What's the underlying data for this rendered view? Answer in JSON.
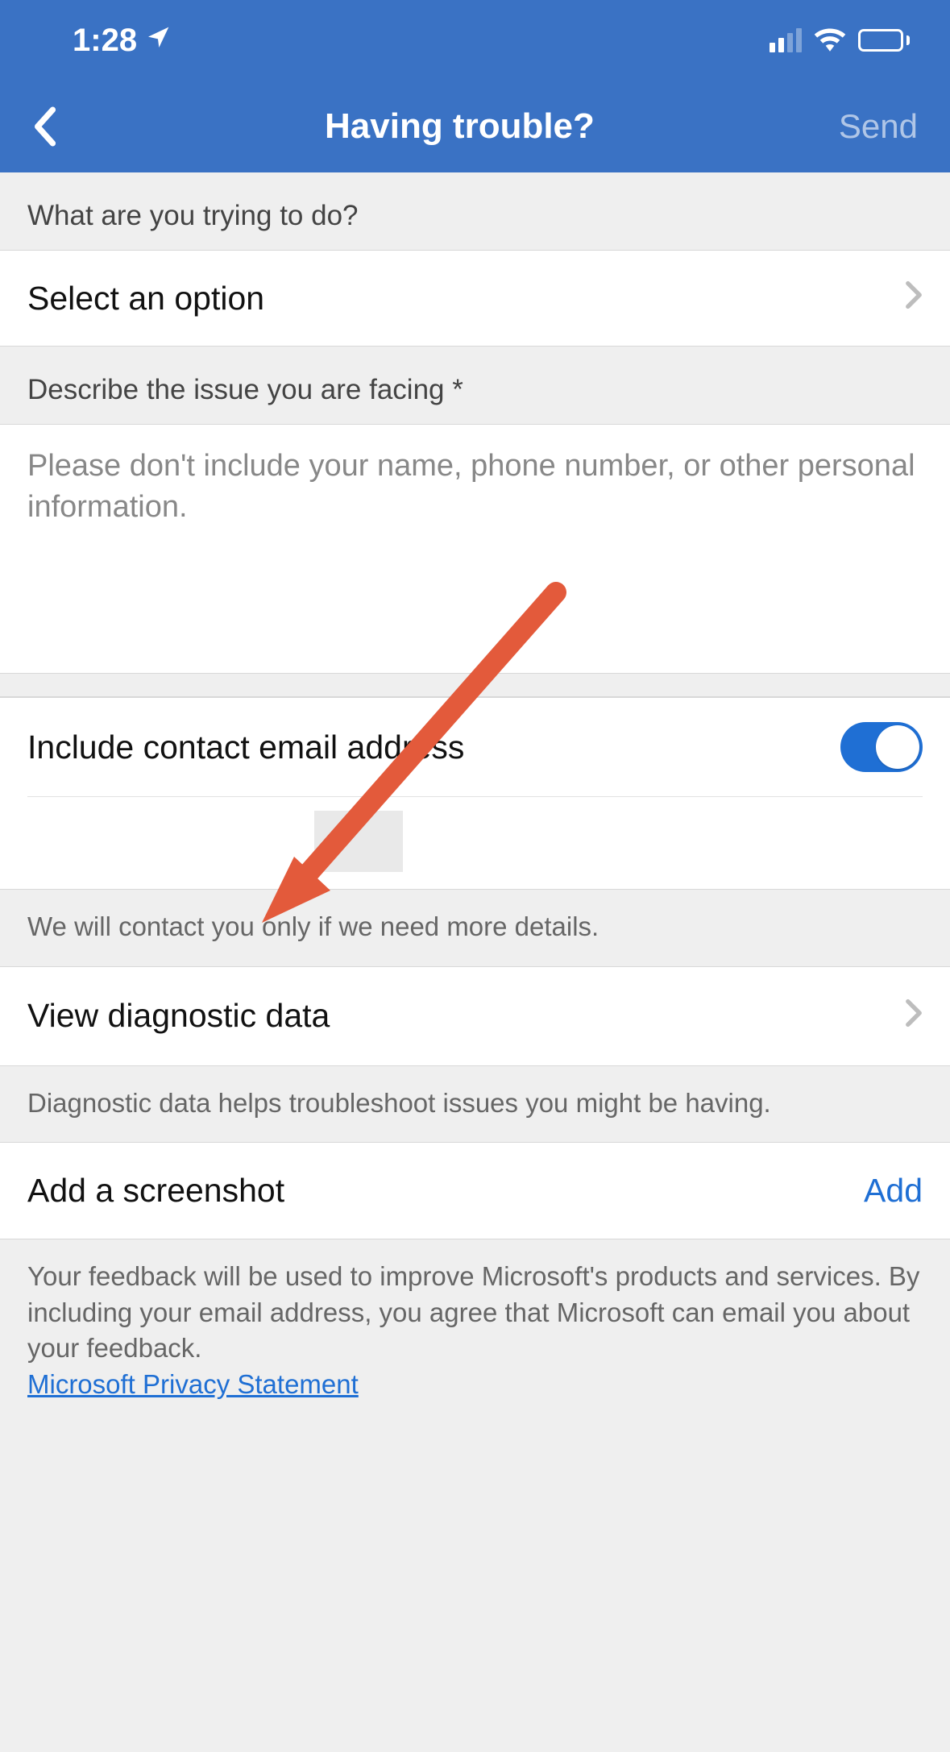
{
  "status": {
    "time": "1:28"
  },
  "nav": {
    "title": "Having trouble?",
    "send": "Send"
  },
  "q1": {
    "label": "What are you trying to do?",
    "value": "Select an option"
  },
  "q2": {
    "label": "Describe the issue you are facing *",
    "placeholder": "Please don't include your name, phone number, or other personal information."
  },
  "contact": {
    "label": "Include contact email address",
    "note": "We will contact you only if we need more details."
  },
  "diag": {
    "label": "View diagnostic data",
    "note": "Diagnostic data helps troubleshoot issues you might be having."
  },
  "screenshot": {
    "label": "Add a screenshot",
    "action": "Add"
  },
  "disclosure": {
    "text": "Your feedback will be used to improve Microsoft's products and services. By including your email address, you agree that Microsoft can email you about your feedback.",
    "link": "Microsoft Privacy Statement"
  }
}
